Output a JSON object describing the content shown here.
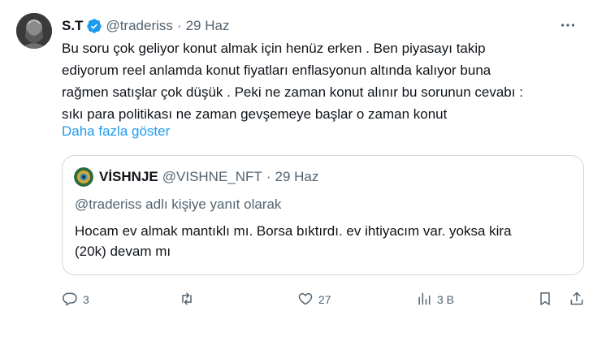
{
  "tweet": {
    "author_name": "S.T",
    "handle": "@traderiss",
    "separator": "·",
    "date": "29 Haz",
    "text": "Bu soru çok geliyor konut almak için henüz erken . Ben piyasayı takip\nediyorum reel anlamda konut fiyatları enflasyonun altında kalıyor buna\nrağmen satışlar çok düşük . Peki ne zaman konut alınır bu sorunun cevabı :\nsıkı para politikası ne zaman gevşemeye başlar o zaman konut",
    "show_more": "Daha fazla göster"
  },
  "quote": {
    "author_name": "VİSHNJE",
    "handle": "@VISHNE_NFT",
    "separator": "·",
    "date": "29 Haz",
    "reply_context": "@traderiss adlı kişiye yanıt olarak",
    "text": "Hocam ev almak mantıklı mı. Borsa bıktırdı. ev ihtiyacım var. yoksa kira\n(20k) devam mı"
  },
  "actions": {
    "replies": "3",
    "retweets": "",
    "likes": "27",
    "views": "3 B"
  },
  "icons": {
    "verified": "verified-badge-icon",
    "more": "more-options-icon",
    "reply": "reply-icon",
    "retweet": "retweet-icon",
    "like": "heart-icon",
    "views": "analytics-icon",
    "bookmark": "bookmark-icon",
    "share": "share-icon"
  },
  "colors": {
    "accent": "#1d9bf0",
    "secondary_text": "#536471",
    "border": "#cfd9de"
  }
}
